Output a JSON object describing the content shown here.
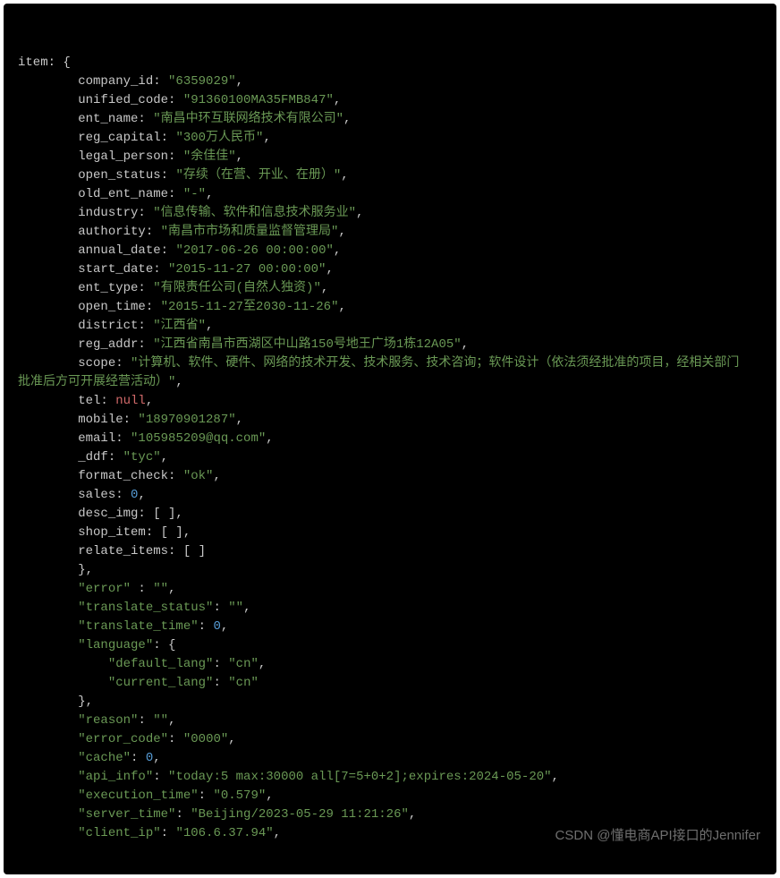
{
  "code": {
    "lines": [
      [
        {
          "t": "item: {",
          "c": "k"
        }
      ],
      [
        {
          "t": "        company_id: ",
          "c": "k"
        },
        {
          "t": "\"6359029\"",
          "c": "s"
        },
        {
          "t": ",",
          "c": "p"
        }
      ],
      [
        {
          "t": "        unified_code: ",
          "c": "k"
        },
        {
          "t": "\"91360100MA35FMB847\"",
          "c": "s"
        },
        {
          "t": ",",
          "c": "p"
        }
      ],
      [
        {
          "t": "        ent_name: ",
          "c": "k"
        },
        {
          "t": "\"南昌中环互联网络技术有限公司\"",
          "c": "s"
        },
        {
          "t": ",",
          "c": "p"
        }
      ],
      [
        {
          "t": "        reg_capital: ",
          "c": "k"
        },
        {
          "t": "\"300万人民币\"",
          "c": "s"
        },
        {
          "t": ",",
          "c": "p"
        }
      ],
      [
        {
          "t": "        legal_person: ",
          "c": "k"
        },
        {
          "t": "\"余佳佳\"",
          "c": "s"
        },
        {
          "t": ",",
          "c": "p"
        }
      ],
      [
        {
          "t": "        open_status: ",
          "c": "k"
        },
        {
          "t": "\"存续（在营、开业、在册）\"",
          "c": "s"
        },
        {
          "t": ",",
          "c": "p"
        }
      ],
      [
        {
          "t": "        old_ent_name: ",
          "c": "k"
        },
        {
          "t": "\"-\"",
          "c": "s"
        },
        {
          "t": ",",
          "c": "p"
        }
      ],
      [
        {
          "t": "        industry: ",
          "c": "k"
        },
        {
          "t": "\"信息传输、软件和信息技术服务业\"",
          "c": "s"
        },
        {
          "t": ",",
          "c": "p"
        }
      ],
      [
        {
          "t": "        authority: ",
          "c": "k"
        },
        {
          "t": "\"南昌市市场和质量监督管理局\"",
          "c": "s"
        },
        {
          "t": ",",
          "c": "p"
        }
      ],
      [
        {
          "t": "        annual_date: ",
          "c": "k"
        },
        {
          "t": "\"2017-06-26 00:00:00\"",
          "c": "s"
        },
        {
          "t": ",",
          "c": "p"
        }
      ],
      [
        {
          "t": "        start_date: ",
          "c": "k"
        },
        {
          "t": "\"2015-11-27 00:00:00\"",
          "c": "s"
        },
        {
          "t": ",",
          "c": "p"
        }
      ],
      [
        {
          "t": "        ent_type: ",
          "c": "k"
        },
        {
          "t": "\"有限责任公司(自然人独资)\"",
          "c": "s"
        },
        {
          "t": ",",
          "c": "p"
        }
      ],
      [
        {
          "t": "        open_time: ",
          "c": "k"
        },
        {
          "t": "\"2015-11-27至2030-11-26\"",
          "c": "s"
        },
        {
          "t": ",",
          "c": "p"
        }
      ],
      [
        {
          "t": "        district: ",
          "c": "k"
        },
        {
          "t": "\"江西省\"",
          "c": "s"
        },
        {
          "t": ",",
          "c": "p"
        }
      ],
      [
        {
          "t": "        reg_addr: ",
          "c": "k"
        },
        {
          "t": "\"江西省南昌市西湖区中山路150号地王广场1栋12A05\"",
          "c": "s"
        },
        {
          "t": ",",
          "c": "p"
        }
      ],
      [
        {
          "t": "        scope: ",
          "c": "k"
        },
        {
          "t": "\"计算机、软件、硬件、网络的技术开发、技术服务、技术咨询；软件设计（依法须经批准的项目，经相关部门",
          "c": "s"
        }
      ],
      [
        {
          "t": "批准后方可开展经营活动）\"",
          "c": "s"
        },
        {
          "t": ",",
          "c": "p"
        }
      ],
      [
        {
          "t": "        tel: ",
          "c": "k"
        },
        {
          "t": "null",
          "c": "nul"
        },
        {
          "t": ",",
          "c": "p"
        }
      ],
      [
        {
          "t": "        mobile: ",
          "c": "k"
        },
        {
          "t": "\"18970901287\"",
          "c": "s"
        },
        {
          "t": ",",
          "c": "p"
        }
      ],
      [
        {
          "t": "        email: ",
          "c": "k"
        },
        {
          "t": "\"105985209@qq.com\"",
          "c": "s"
        },
        {
          "t": ",",
          "c": "p"
        }
      ],
      [
        {
          "t": "        _ddf: ",
          "c": "k"
        },
        {
          "t": "\"tyc\"",
          "c": "s"
        },
        {
          "t": ",",
          "c": "p"
        }
      ],
      [
        {
          "t": "        format_check: ",
          "c": "k"
        },
        {
          "t": "\"ok\"",
          "c": "s"
        },
        {
          "t": ",",
          "c": "p"
        }
      ],
      [
        {
          "t": "        sales: ",
          "c": "k"
        },
        {
          "t": "0",
          "c": "n"
        },
        {
          "t": ",",
          "c": "p"
        }
      ],
      [
        {
          "t": "        desc_img: [ ],",
          "c": "k"
        }
      ],
      [
        {
          "t": "        shop_item: [ ],",
          "c": "k"
        }
      ],
      [
        {
          "t": "        relate_items: [ ]",
          "c": "k"
        }
      ],
      [
        {
          "t": "        },",
          "c": "k"
        }
      ],
      [
        {
          "t": "        ",
          "c": "p"
        },
        {
          "t": "\"error\"",
          "c": "qk"
        },
        {
          "t": " : ",
          "c": "p"
        },
        {
          "t": "\"\"",
          "c": "s"
        },
        {
          "t": ",",
          "c": "p"
        }
      ],
      [
        {
          "t": "        ",
          "c": "p"
        },
        {
          "t": "\"translate_status\"",
          "c": "qk"
        },
        {
          "t": ": ",
          "c": "p"
        },
        {
          "t": "\"\"",
          "c": "s"
        },
        {
          "t": ",",
          "c": "p"
        }
      ],
      [
        {
          "t": "        ",
          "c": "p"
        },
        {
          "t": "\"translate_time\"",
          "c": "qk"
        },
        {
          "t": ": ",
          "c": "p"
        },
        {
          "t": "0",
          "c": "n"
        },
        {
          "t": ",",
          "c": "p"
        }
      ],
      [
        {
          "t": "        ",
          "c": "p"
        },
        {
          "t": "\"language\"",
          "c": "qk"
        },
        {
          "t": ": {",
          "c": "p"
        }
      ],
      [
        {
          "t": "            ",
          "c": "p"
        },
        {
          "t": "\"default_lang\"",
          "c": "qk"
        },
        {
          "t": ": ",
          "c": "p"
        },
        {
          "t": "\"cn\"",
          "c": "s"
        },
        {
          "t": ",",
          "c": "p"
        }
      ],
      [
        {
          "t": "            ",
          "c": "p"
        },
        {
          "t": "\"current_lang\"",
          "c": "qk"
        },
        {
          "t": ": ",
          "c": "p"
        },
        {
          "t": "\"cn\"",
          "c": "s"
        }
      ],
      [
        {
          "t": "        },",
          "c": "p"
        }
      ],
      [
        {
          "t": "        ",
          "c": "p"
        },
        {
          "t": "\"reason\"",
          "c": "qk"
        },
        {
          "t": ": ",
          "c": "p"
        },
        {
          "t": "\"\"",
          "c": "s"
        },
        {
          "t": ",",
          "c": "p"
        }
      ],
      [
        {
          "t": "        ",
          "c": "p"
        },
        {
          "t": "\"error_code\"",
          "c": "qk"
        },
        {
          "t": ": ",
          "c": "p"
        },
        {
          "t": "\"0000\"",
          "c": "s"
        },
        {
          "t": ",",
          "c": "p"
        }
      ],
      [
        {
          "t": "        ",
          "c": "p"
        },
        {
          "t": "\"cache\"",
          "c": "qk"
        },
        {
          "t": ": ",
          "c": "p"
        },
        {
          "t": "0",
          "c": "n"
        },
        {
          "t": ",",
          "c": "p"
        }
      ],
      [
        {
          "t": "        ",
          "c": "p"
        },
        {
          "t": "\"api_info\"",
          "c": "qk"
        },
        {
          "t": ": ",
          "c": "p"
        },
        {
          "t": "\"today:5 max:30000 all[7=5+0+2];expires:2024-05-20\"",
          "c": "s"
        },
        {
          "t": ",",
          "c": "p"
        }
      ],
      [
        {
          "t": "        ",
          "c": "p"
        },
        {
          "t": "\"execution_time\"",
          "c": "qk"
        },
        {
          "t": ": ",
          "c": "p"
        },
        {
          "t": "\"0.579\"",
          "c": "s"
        },
        {
          "t": ",",
          "c": "p"
        }
      ],
      [
        {
          "t": "        ",
          "c": "p"
        },
        {
          "t": "\"server_time\"",
          "c": "qk"
        },
        {
          "t": ": ",
          "c": "p"
        },
        {
          "t": "\"Beijing/2023-05-29 11:21:26\"",
          "c": "s"
        },
        {
          "t": ",",
          "c": "p"
        }
      ],
      [
        {
          "t": "        ",
          "c": "p"
        },
        {
          "t": "\"client_ip\"",
          "c": "qk"
        },
        {
          "t": ": ",
          "c": "p"
        },
        {
          "t": "\"106.6.37.94\"",
          "c": "s"
        },
        {
          "t": ",",
          "c": "p"
        }
      ]
    ],
    "watermark": "CSDN @懂电商API接口的Jennifer"
  }
}
